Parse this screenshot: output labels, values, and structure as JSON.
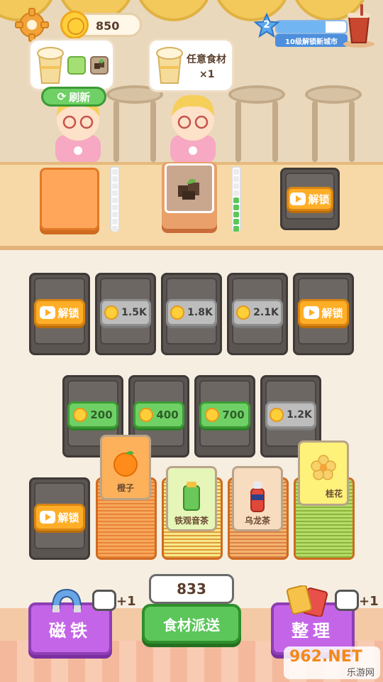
{
  "hud": {
    "coins": "850",
    "level": "2",
    "level_caption": "10级解锁新城市",
    "level_progress": 0.7
  },
  "orders": [
    {
      "items": [
        "cup-icon",
        "green-tea-icon",
        "brown-sugar-icon"
      ],
      "refresh_label": "刷新"
    },
    {
      "text": "任意食材",
      "count": "×1"
    }
  ],
  "counter": {
    "unlock_label": "解锁",
    "meter_right_filled": 5
  },
  "grid": {
    "row1": [
      {
        "type": "ad",
        "label": "解锁"
      },
      {
        "type": "gray",
        "price": "1.5K"
      },
      {
        "type": "gray",
        "price": "1.8K"
      },
      {
        "type": "gray",
        "price": "2.1K"
      },
      {
        "type": "ad",
        "label": "解锁"
      }
    ],
    "row2": [
      {
        "type": "green",
        "price": "200"
      },
      {
        "type": "green",
        "price": "400"
      },
      {
        "type": "green",
        "price": "700"
      },
      {
        "type": "gray",
        "price": "1.2K"
      }
    ],
    "row3_unlock": "解锁",
    "stacks": [
      {
        "name": "橙子",
        "color": "#fdb15a"
      },
      {
        "name": "铁观音茶",
        "color": "#e6f6b8"
      },
      {
        "name": "乌龙茶",
        "color": "#f8dcc0"
      },
      {
        "name": "桂花",
        "color": "#fff27a"
      }
    ]
  },
  "bottom": {
    "magnet_label": "磁铁",
    "magnet_plus": "+1",
    "deliver_count": "833",
    "deliver_label": "食材派送",
    "sort_label": "整理",
    "sort_plus": "+1"
  },
  "watermark": {
    "text": "962.NET",
    "sub": "乐游网"
  }
}
